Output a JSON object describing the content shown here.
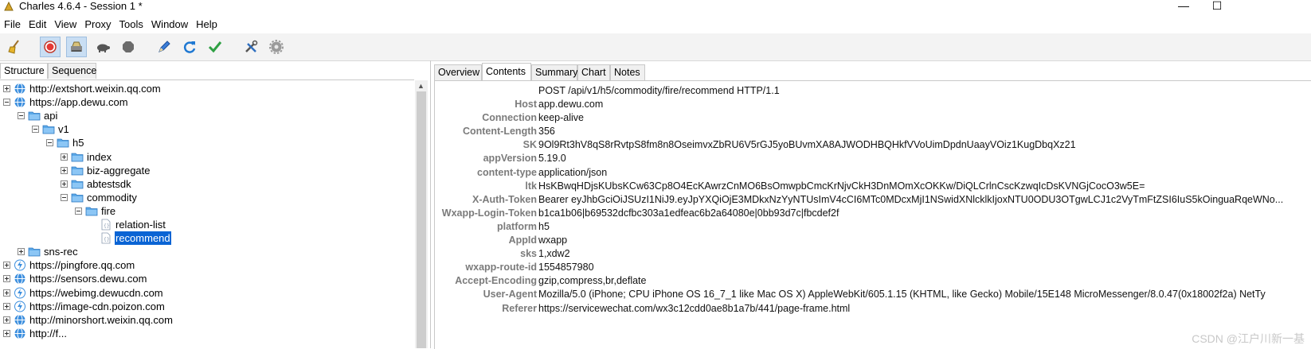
{
  "window": {
    "title": "Charles 4.6.4 - Session 1 *",
    "minimize": "—",
    "maximize": "☐"
  },
  "menu": [
    "File",
    "Edit",
    "View",
    "Proxy",
    "Tools",
    "Window",
    "Help"
  ],
  "toolbar": {
    "icons": [
      "broom-icon",
      "record-icon",
      "throttle-icon",
      "turtle-icon",
      "stop-icon",
      "pen-icon",
      "refresh-icon",
      "check-icon",
      "tools-icon",
      "gear-icon"
    ]
  },
  "left_tabs": [
    "Structure",
    "Sequence"
  ],
  "tree": [
    {
      "label": "http://extshort.weixin.qq.com",
      "depth": 0,
      "kind": "globe",
      "exp": "plus"
    },
    {
      "label": "https://app.dewu.com",
      "depth": 0,
      "kind": "globe",
      "exp": "minus"
    },
    {
      "label": "api",
      "depth": 1,
      "kind": "folder",
      "exp": "minus"
    },
    {
      "label": "v1",
      "depth": 2,
      "kind": "folder",
      "exp": "minus"
    },
    {
      "label": "h5",
      "depth": 3,
      "kind": "folder",
      "exp": "minus"
    },
    {
      "label": "index",
      "depth": 4,
      "kind": "folder",
      "exp": "plus"
    },
    {
      "label": "biz-aggregate",
      "depth": 4,
      "kind": "folder",
      "exp": "plus"
    },
    {
      "label": "abtestsdk",
      "depth": 4,
      "kind": "folder",
      "exp": "plus"
    },
    {
      "label": "commodity",
      "depth": 4,
      "kind": "folder",
      "exp": "minus"
    },
    {
      "label": "fire",
      "depth": 5,
      "kind": "folder",
      "exp": "minus"
    },
    {
      "label": "relation-list",
      "depth": 6,
      "kind": "file",
      "exp": "none"
    },
    {
      "label": "recommend",
      "depth": 6,
      "kind": "file",
      "exp": "none",
      "selected": true
    },
    {
      "label": "sns-rec",
      "depth": 1,
      "kind": "folder",
      "exp": "plus"
    },
    {
      "label": "https://pingfore.qq.com",
      "depth": 0,
      "kind": "bolt",
      "exp": "plus"
    },
    {
      "label": "https://sensors.dewu.com",
      "depth": 0,
      "kind": "globe",
      "exp": "plus"
    },
    {
      "label": "https://webimg.dewucdn.com",
      "depth": 0,
      "kind": "bolt",
      "exp": "plus"
    },
    {
      "label": "https://image-cdn.poizon.com",
      "depth": 0,
      "kind": "bolt",
      "exp": "plus"
    },
    {
      "label": "http://minorshort.weixin.qq.com",
      "depth": 0,
      "kind": "globe",
      "exp": "plus"
    },
    {
      "label": "http://f...",
      "depth": 0,
      "kind": "globe",
      "exp": "plus"
    }
  ],
  "right_tabs": [
    "Overview",
    "Contents",
    "Summary",
    "Chart",
    "Notes"
  ],
  "request_line": "POST /api/v1/h5/commodity/fire/recommend HTTP/1.1",
  "headers": [
    {
      "key": "Host",
      "value": "app.dewu.com"
    },
    {
      "key": "Connection",
      "value": "keep-alive"
    },
    {
      "key": "Content-Length",
      "value": "356"
    },
    {
      "key": "SK",
      "value": "9Ol9Rt3hV8qS8rRvtpS8fm8n8OseimvxZbRU6V5rGJ5yoBUvmXA8AJWODHBQHkfVVoUimDpdnUaayVOiz1KugDbqXz21"
    },
    {
      "key": "appVersion",
      "value": "5.19.0"
    },
    {
      "key": "content-type",
      "value": "application/json"
    },
    {
      "key": "ltk",
      "value": "HsKBwqHDjsKUbsKCw63Cp8O4EcKAwrzCnMO6BsOmwpbCmcKrNjvCkH3DnMOmXcOKKw/DiQLCrlnCscKzwqIcDsKVNGjCocO3w5E="
    },
    {
      "key": "X-Auth-Token",
      "value": "Bearer eyJhbGciOiJSUzI1NiJ9.eyJpYXQiOjE3MDkxNzYyNTUsImV4cCI6MTc0MDcxMjI1NSwidXNlcklkIjoxNTU0ODU3OTgwLCJ1c2VyTmFtZSI6IuS5kOinguaRqeWNo..."
    },
    {
      "key": "Wxapp-Login-Token",
      "value": "b1ca1b06|b69532dcfbc303a1edfeac6b2a64080e|0bb93d7c|fbcdef2f"
    },
    {
      "key": "platform",
      "value": "h5"
    },
    {
      "key": "AppId",
      "value": "wxapp"
    },
    {
      "key": "sks",
      "value": "1,xdw2"
    },
    {
      "key": "wxapp-route-id",
      "value": "1554857980"
    },
    {
      "key": "Accept-Encoding",
      "value": "gzip,compress,br,deflate"
    },
    {
      "key": "User-Agent",
      "value": "Mozilla/5.0 (iPhone; CPU iPhone OS 16_7_1 like Mac OS X) AppleWebKit/605.1.15 (KHTML, like Gecko) Mobile/15E148 MicroMessenger/8.0.47(0x18002f2a) NetTy"
    },
    {
      "key": "Referer",
      "value": "https://servicewechat.com/wx3c12cdd0ae8b1a7b/441/page-frame.html"
    }
  ],
  "watermark": "CSDN @江户川新一基"
}
